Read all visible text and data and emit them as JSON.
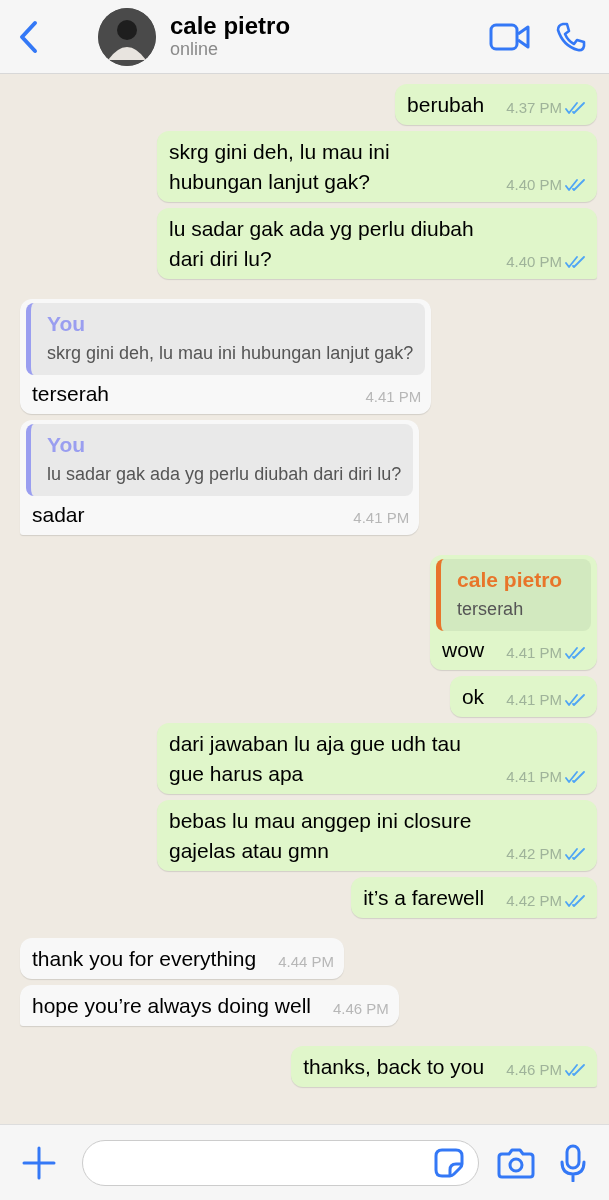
{
  "header": {
    "name": "cale pietro",
    "status": "online"
  },
  "messages": [
    {
      "kind": "sent",
      "text": "berubah",
      "time": "4.37 PM",
      "read": true,
      "tail": false
    },
    {
      "kind": "sent",
      "text": "skrg gini deh, lu mau ini hubungan lanjut gak?",
      "time": "4.40 PM",
      "read": true,
      "tail": false
    },
    {
      "kind": "sent",
      "text": "lu sadar gak ada yg perlu diubah dari diri lu?",
      "time": "4.40 PM",
      "read": true,
      "tail": true
    },
    {
      "kind": "received",
      "text": "terserah",
      "time": "4.41 PM",
      "tail": false,
      "reply": {
        "author": "You",
        "text": "skrg gini deh, lu mau ini hubungan lanjut gak?",
        "color": "#9a9ef0"
      }
    },
    {
      "kind": "received",
      "text": "sadar",
      "time": "4.41 PM",
      "tail": true,
      "reply": {
        "author": "You",
        "text": "lu sadar gak ada yg perlu diubah dari diri lu?",
        "color": "#9a9ef0"
      }
    },
    {
      "kind": "sent",
      "text": "wow",
      "time": "4.41 PM",
      "read": true,
      "tail": false,
      "reply": {
        "author": "cale pietro",
        "text": "terserah",
        "color": "#e8752a"
      }
    },
    {
      "kind": "sent",
      "text": "ok",
      "time": "4.41 PM",
      "read": true,
      "tail": false
    },
    {
      "kind": "sent",
      "text": "dari jawaban lu aja gue udh tau gue harus apa",
      "time": "4.41 PM",
      "read": true,
      "tail": false
    },
    {
      "kind": "sent",
      "text": "bebas lu mau anggep ini closure gajelas atau gmn",
      "time": "4.42 PM",
      "read": true,
      "tail": false
    },
    {
      "kind": "sent",
      "text": "it’s a farewell",
      "time": "4.42 PM",
      "read": true,
      "tail": true
    },
    {
      "kind": "received",
      "text": "thank you for everything",
      "time": "4.44 PM",
      "tail": false
    },
    {
      "kind": "received",
      "text": "hope you’re always doing well",
      "time": "4.46 PM",
      "tail": true
    },
    {
      "kind": "sent",
      "text": "thanks, back to you",
      "time": "4.46 PM",
      "read": true,
      "tail": true
    }
  ]
}
